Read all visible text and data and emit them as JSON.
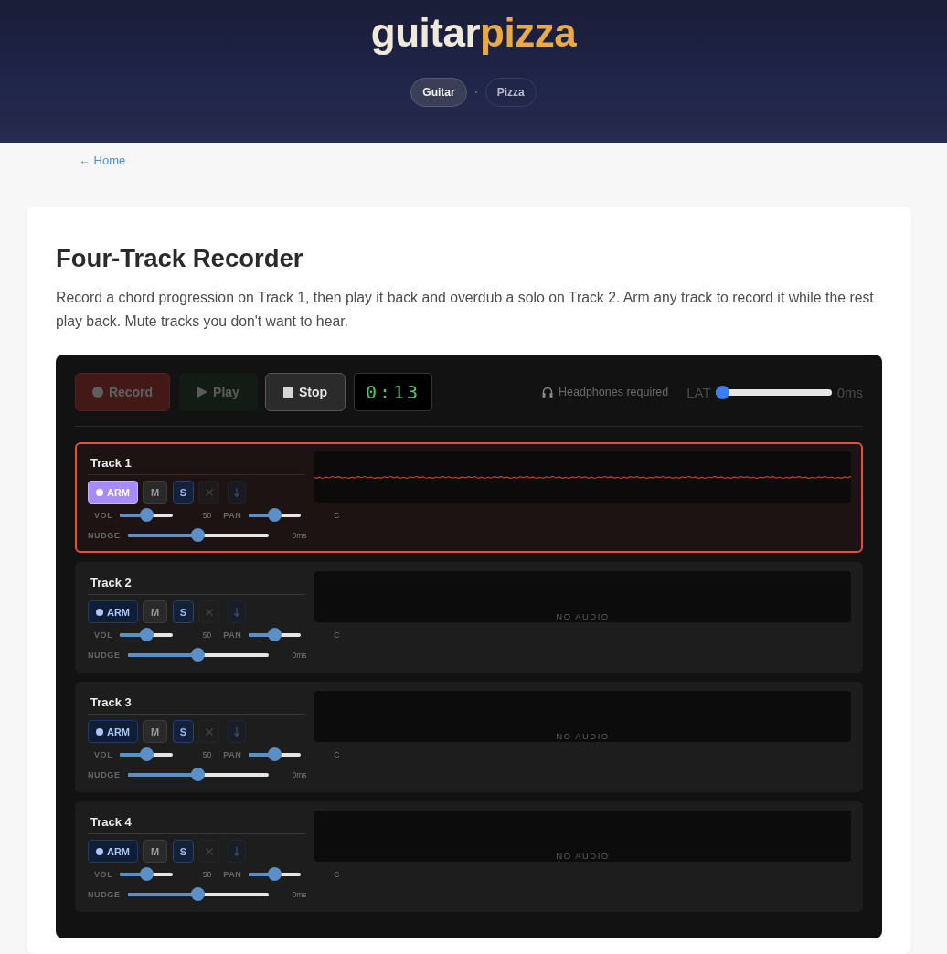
{
  "header": {
    "logo": {
      "first": "guitar",
      "second": "pizza"
    },
    "nav": [
      {
        "label": "Guitar",
        "selected": true
      },
      {
        "label": "Pizza",
        "selected": false
      }
    ]
  },
  "back_link": "← Home",
  "page": {
    "title": "Four-Track Recorder",
    "description": "Record a chord progression on Track 1, then play it back and overdub a solo on Track 2. Arm any track to record it while the rest play back. Mute tracks you don't want to hear."
  },
  "recorder": {
    "transport": [
      {
        "kind": "record",
        "label": "Record",
        "disabled": true
      },
      {
        "kind": "play",
        "label": "Play",
        "disabled": true
      },
      {
        "kind": "stop",
        "label": "Stop",
        "disabled": false
      }
    ],
    "time": "0:13",
    "notice": "Headphones required",
    "latency": {
      "label": "LAT",
      "level": 0,
      "reading": "0ms"
    },
    "tracks": [
      {
        "name": "Track 1",
        "recording": true,
        "buttons": [
          {
            "kind": "arm",
            "label": "ARM",
            "on": true,
            "disabled": false
          },
          {
            "kind": "mute",
            "label": "M",
            "on": false,
            "disabled": false
          },
          {
            "kind": "solo",
            "label": "S",
            "on": false,
            "disabled": false
          },
          {
            "kind": "clear",
            "on": false,
            "disabled": true
          },
          {
            "kind": "export",
            "on": false,
            "disabled": true
          }
        ],
        "waveform": {
          "kind": "recording"
        },
        "volume": {
          "label": "VOL",
          "level": 0.5,
          "reading": "50"
        },
        "pan": {
          "label": "PAN",
          "level": 0.5,
          "reading": "C"
        },
        "nudge": {
          "label": "NUDGE",
          "level": 0.5,
          "reading": "0ms"
        }
      },
      {
        "name": "Track 2",
        "recording": false,
        "buttons": [
          {
            "kind": "arm",
            "label": "ARM",
            "on": false,
            "disabled": false
          },
          {
            "kind": "mute",
            "label": "M",
            "on": false,
            "disabled": false
          },
          {
            "kind": "solo",
            "label": "S",
            "on": false,
            "disabled": false
          },
          {
            "kind": "clear",
            "on": false,
            "disabled": true
          },
          {
            "kind": "export",
            "on": false,
            "disabled": true
          }
        ],
        "waveform": {
          "kind": "empty",
          "text": "NO AUDIO"
        },
        "volume": {
          "label": "VOL",
          "level": 0.5,
          "reading": "50"
        },
        "pan": {
          "label": "PAN",
          "level": 0.5,
          "reading": "C"
        },
        "nudge": {
          "label": "NUDGE",
          "level": 0.5,
          "reading": "0ms"
        }
      },
      {
        "name": "Track 3",
        "recording": false,
        "buttons": [
          {
            "kind": "arm",
            "label": "ARM",
            "on": false,
            "disabled": false
          },
          {
            "kind": "mute",
            "label": "M",
            "on": false,
            "disabled": false
          },
          {
            "kind": "solo",
            "label": "S",
            "on": false,
            "disabled": false
          },
          {
            "kind": "clear",
            "on": false,
            "disabled": true
          },
          {
            "kind": "export",
            "on": false,
            "disabled": true
          }
        ],
        "waveform": {
          "kind": "empty",
          "text": "NO AUDIO"
        },
        "volume": {
          "label": "VOL",
          "level": 0.5,
          "reading": "50"
        },
        "pan": {
          "label": "PAN",
          "level": 0.5,
          "reading": "C"
        },
        "nudge": {
          "label": "NUDGE",
          "level": 0.5,
          "reading": "0ms"
        }
      },
      {
        "name": "Track 4",
        "recording": false,
        "buttons": [
          {
            "kind": "arm",
            "label": "ARM",
            "on": false,
            "disabled": false
          },
          {
            "kind": "mute",
            "label": "M",
            "on": false,
            "disabled": false
          },
          {
            "kind": "solo",
            "label": "S",
            "on": false,
            "disabled": false
          },
          {
            "kind": "clear",
            "on": false,
            "disabled": true
          },
          {
            "kind": "export",
            "on": false,
            "disabled": true
          }
        ],
        "waveform": {
          "kind": "empty",
          "text": "NO AUDIO"
        },
        "volume": {
          "label": "VOL",
          "level": 0.5,
          "reading": "50"
        },
        "pan": {
          "label": "PAN",
          "level": 0.5,
          "reading": "C"
        },
        "nudge": {
          "label": "NUDGE",
          "level": 0.5,
          "reading": "0ms"
        }
      }
    ]
  }
}
